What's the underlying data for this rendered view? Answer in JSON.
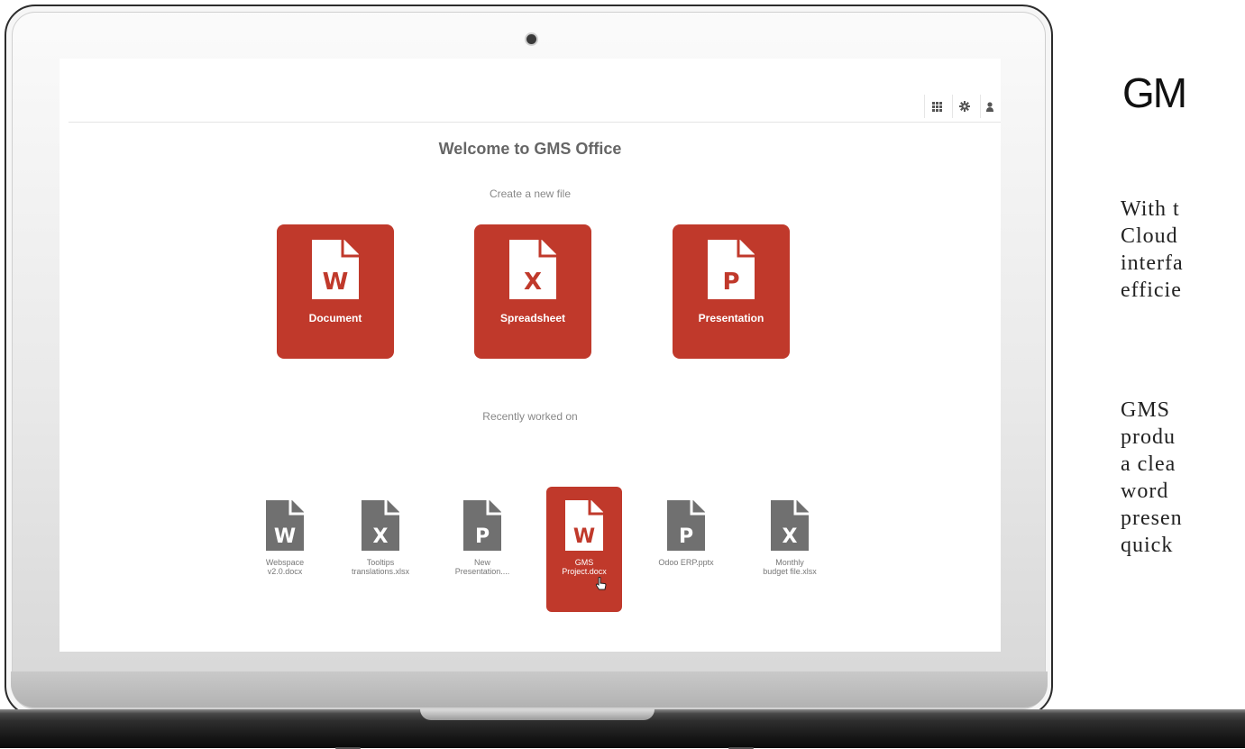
{
  "app": {
    "welcome_title": "Welcome to GMS Office",
    "create_label": "Create a new file",
    "recent_label": "Recently worked on"
  },
  "colors": {
    "accent": "#c0392b",
    "inactive_icon": "#707070"
  },
  "topbar": {
    "buttons": [
      {
        "icon": "apps-grid-icon",
        "glyph": "▦"
      },
      {
        "icon": "gear-icon",
        "glyph": "✹"
      },
      {
        "icon": "user-icon",
        "glyph": "♟"
      }
    ]
  },
  "new_files": [
    {
      "letter": "W",
      "label": "Document",
      "icon": "word-document-icon"
    },
    {
      "letter": "X",
      "label": "Spreadsheet",
      "icon": "excel-spreadsheet-icon"
    },
    {
      "letter": "P",
      "label": "Presentation",
      "icon": "powerpoint-presentation-icon"
    }
  ],
  "recent_files": [
    {
      "letter": "W",
      "name": "Webspace\nv2.0.docx",
      "selected": false
    },
    {
      "letter": "X",
      "name": "Tooltips\ntranslations.xlsx",
      "selected": false
    },
    {
      "letter": "P",
      "name": "New\nPresentation....",
      "selected": false
    },
    {
      "letter": "W",
      "name": "GMS\nProject.docx",
      "selected": true
    },
    {
      "letter": "P",
      "name": "Odoo ERP.pptx",
      "selected": false
    },
    {
      "letter": "X",
      "name": "Monthly\nbudget file.xlsx",
      "selected": false
    }
  ],
  "side": {
    "title": "GM",
    "para1": [
      "With t",
      "Cloud",
      "interfa",
      "efficie"
    ],
    "para2": [
      "GMS",
      "produ",
      "a clea",
      "word",
      "presen",
      "quick"
    ]
  }
}
